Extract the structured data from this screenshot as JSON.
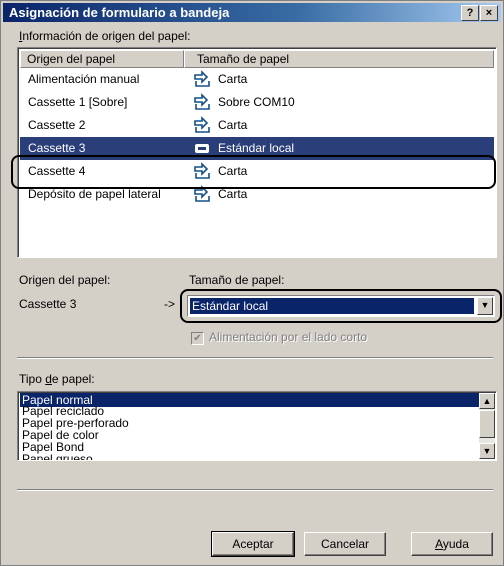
{
  "window": {
    "title": "Asignación de formulario a bandeja",
    "help_button": "?",
    "close_button": "×"
  },
  "origin_info": {
    "label_prefix": "I",
    "label_rest": "nformación de origen del papel:",
    "columns": [
      "Origen del papel",
      "Tamaño de papel"
    ],
    "rows": [
      {
        "source": "Alimentación manual",
        "size": "Carta"
      },
      {
        "source": "Cassette 1 [Sobre]",
        "size": "Sobre COM10"
      },
      {
        "source": "Cassette 2",
        "size": "Carta"
      },
      {
        "source": "Cassette 3",
        "size": "Estándar local",
        "selected": true
      },
      {
        "source": "Cassette 4",
        "size": "Carta"
      },
      {
        "source": "Depósito de papel lateral",
        "size": "Carta"
      }
    ]
  },
  "selection": {
    "source_label": "Origen del papel:",
    "size_label": "Tamaño de papel:",
    "source_value": "Cassette 3",
    "arrow": "->",
    "size_value": "Estándar local",
    "short_edge_label": "Alimentación por el lado corto",
    "short_edge_checked": true
  },
  "paper_type": {
    "label_prefix": "Tipo ",
    "label_underlined": "d",
    "label_rest": "e papel:",
    "items": [
      "Papel normal",
      "Papel reciclado",
      "Papel pre-perforado",
      "Papel de color",
      "Papel Bond",
      "Papel grueso"
    ],
    "selected_index": 0
  },
  "buttons": {
    "ok": "Aceptar",
    "cancel": "Cancelar",
    "help_underlined": "A",
    "help_rest": "yuda"
  }
}
